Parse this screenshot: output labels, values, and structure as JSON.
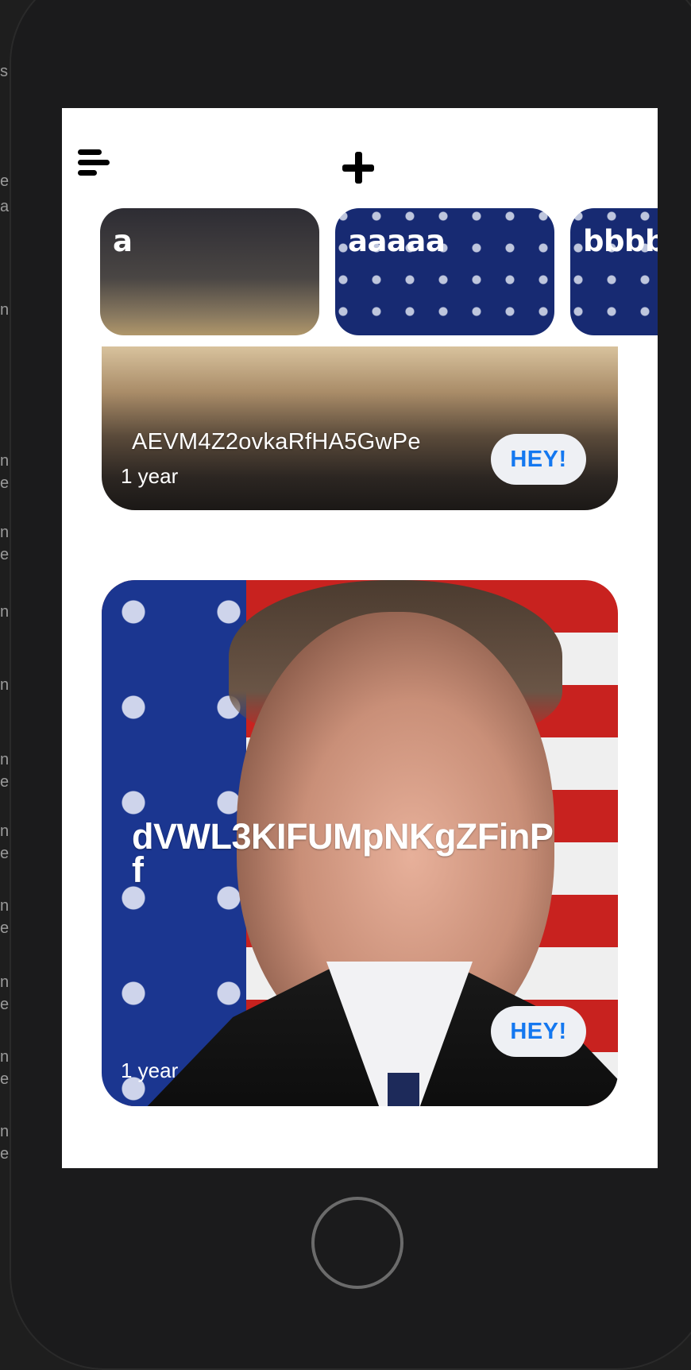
{
  "header": {
    "menu_icon": "hamburger-menu-icon",
    "add_icon": "plus-icon"
  },
  "stories": [
    {
      "label": "a",
      "image": "desert-silhouette"
    },
    {
      "label": "aaaaa",
      "image": "flag-portrait"
    },
    {
      "label": "bbbb",
      "image": "flag-stars"
    }
  ],
  "feed": [
    {
      "title": "AEVM4Z2ovkaRfHA5GwPe",
      "age": "1 year",
      "action_label": "HEY!"
    },
    {
      "title": "dVWL3KIFUMpNKgZFinPf",
      "age": "1 year",
      "action_label": "HEY!"
    }
  ],
  "colors": {
    "accent": "#1478f0",
    "button_bg": "#eef0f4",
    "screen_bg": "#ffffff",
    "frame": "#1b1b1c"
  }
}
